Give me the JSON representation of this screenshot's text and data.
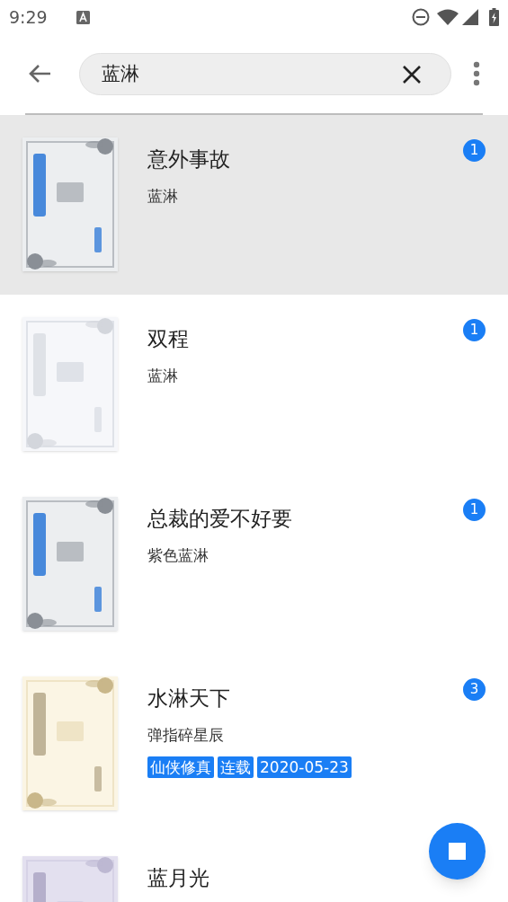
{
  "status_bar": {
    "time": "9:29"
  },
  "search": {
    "value": "蓝淋"
  },
  "results": [
    {
      "title": "意外事故",
      "author": "蓝淋",
      "count": "1",
      "selected": true
    },
    {
      "title": "双程",
      "author": "蓝淋",
      "count": "1",
      "selected": false
    },
    {
      "title": "总裁的爱不好要",
      "author": "紫色蓝淋",
      "count": "1",
      "selected": false
    },
    {
      "title": "水淋天下",
      "author": "弹指碎星辰",
      "count": "3",
      "selected": false,
      "tags": [
        "仙侠修真",
        "连载",
        "2020-05-23"
      ]
    },
    {
      "title": "蓝月光",
      "selected": false
    }
  ]
}
